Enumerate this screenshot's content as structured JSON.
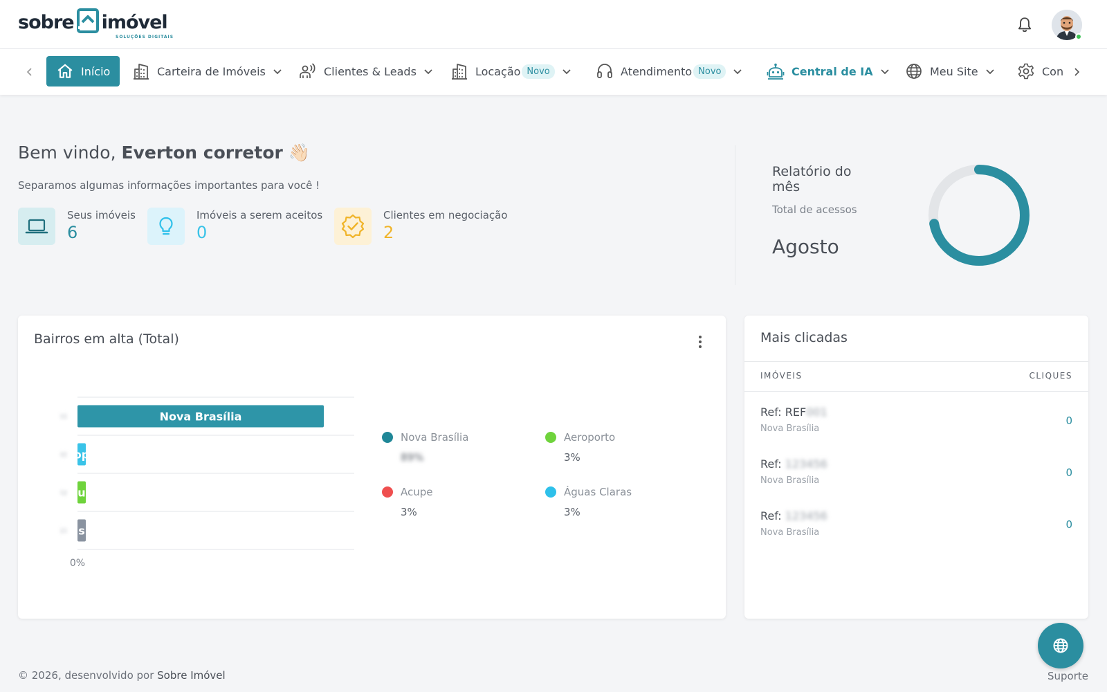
{
  "brand": {
    "word1": "sobre",
    "word2": "imóvel",
    "tagline": "SOLUÇÕES DIGITAIS",
    "accent": "#2b8ea0"
  },
  "header": {
    "bell_icon": "bell-icon",
    "avatar_icon": "user-avatar"
  },
  "nav": {
    "items": [
      {
        "label": "Início",
        "icon": "home-icon"
      },
      {
        "label": "Carteira de Imóveis",
        "icon": "building-icon"
      },
      {
        "label": "Clientes & Leads",
        "icon": "user-broadcast-icon"
      },
      {
        "label": "Locação",
        "badge": "Novo",
        "icon": "building-icon"
      },
      {
        "label": "Atendimento",
        "badge": "Novo",
        "icon": "headset-icon"
      },
      {
        "label": "Central de IA",
        "icon": "robot-icon"
      },
      {
        "label": "Meu Site",
        "icon": "globe-icon"
      },
      {
        "label": "Con",
        "icon": "gear-icon"
      }
    ]
  },
  "welcome": {
    "greeting": "Bem vindo, ",
    "name": "Everton corretor",
    "emoji": "👋🏻",
    "subtitle": "Separamos algumas informações importantes para você !"
  },
  "stats": [
    {
      "label": "Seus imóveis",
      "value": "6",
      "color": "#2b8ea0",
      "icon": "laptop-icon"
    },
    {
      "label": "Imóveis a serem aceitos",
      "value": "0",
      "color": "#3ac3e8",
      "icon": "lightbulb-icon"
    },
    {
      "label": "Clientes em negociação",
      "value": "2",
      "color": "#f0b429",
      "icon": "badge-check-icon"
    }
  ],
  "report": {
    "title": "Relatório do mês",
    "subtitle": "Total de acessos",
    "month": "Agosto",
    "donut_fraction": 0.72
  },
  "bairros_card": {
    "title": "Bairros em alta (Total)"
  },
  "chart_data": {
    "type": "bar",
    "orientation": "horizontal",
    "categories": [
      "Nova Brasília",
      "Aeroporto",
      "Acupe",
      "Águas Claras"
    ],
    "values": [
      89,
      3,
      3,
      3
    ],
    "bar_labels": [
      "Nova Brasília",
      "op",
      "u",
      "s"
    ],
    "colors": [
      "#2e95a8",
      "#3ac3e8",
      "#6fd33c",
      "#8a93a0"
    ],
    "xlim": [
      0,
      100
    ],
    "x_tick_labels": [
      "0%"
    ],
    "grid": true,
    "legend": [
      {
        "name": "Nova Brasília",
        "value": "89%",
        "color": "#1f8797"
      },
      {
        "name": "Aeroporto",
        "value": "3%",
        "color": "#6fd33c"
      },
      {
        "name": "Acupe",
        "value": "3%",
        "color": "#ef4f4f"
      },
      {
        "name": "Águas Claras",
        "value": "3%",
        "color": "#2ec0ea"
      }
    ],
    "legend_placement": "right"
  },
  "clicadas": {
    "title": "Mais clicadas",
    "col_imoveis": "IMÓVEIS",
    "col_cliques": "CLIQUES",
    "rows": [
      {
        "ref": "Ref: REF",
        "hidden": "001",
        "bairro": "Nova Brasília",
        "cliques": "0"
      },
      {
        "ref": "Ref: ",
        "hidden": "123456",
        "bairro": "Nova Brasília",
        "cliques": "0"
      },
      {
        "ref": "Ref: ",
        "hidden": "123456",
        "bairro": "Nova Brasília",
        "cliques": "0"
      }
    ]
  },
  "footer": {
    "text": "© 2026, desenvolvido por ",
    "brand": "Sobre Imóvel"
  },
  "support": {
    "label": "Suporte",
    "icon": "globe-icon"
  }
}
